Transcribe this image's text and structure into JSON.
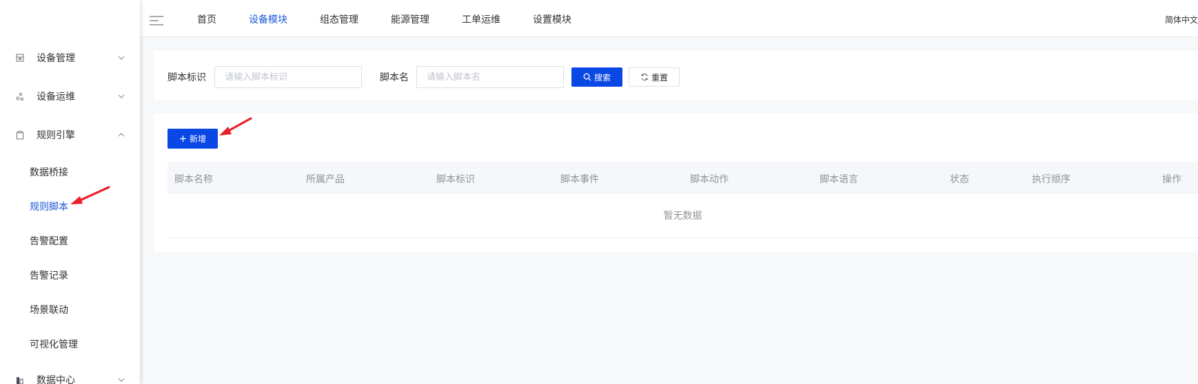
{
  "sidebar": {
    "groups": [
      {
        "label": "设备管理",
        "icon": "device-box-icon",
        "expanded": false
      },
      {
        "label": "设备运维",
        "icon": "nodes-icon",
        "expanded": false
      },
      {
        "label": "规则引擎",
        "icon": "clipboard-icon",
        "expanded": true
      },
      {
        "label": "数据中心",
        "icon": "database-icon",
        "expanded": false
      }
    ],
    "rule_engine_items": [
      {
        "label": "数据桥接",
        "active": false
      },
      {
        "label": "规则脚本",
        "active": true
      },
      {
        "label": "告警配置",
        "active": false
      },
      {
        "label": "告警记录",
        "active": false
      },
      {
        "label": "场景联动",
        "active": false
      },
      {
        "label": "可视化管理",
        "active": false
      }
    ]
  },
  "topnav": {
    "tabs": [
      {
        "label": "首页",
        "active": false
      },
      {
        "label": "设备模块",
        "active": true
      },
      {
        "label": "组态管理",
        "active": false
      },
      {
        "label": "能源管理",
        "active": false
      },
      {
        "label": "工单运维",
        "active": false
      },
      {
        "label": "设置模块",
        "active": false
      }
    ],
    "language": "简体中文"
  },
  "search": {
    "script_id_label": "脚本标识",
    "script_id_placeholder": "请输入脚本标识",
    "script_id_value": "",
    "script_name_label": "脚本名",
    "script_name_placeholder": "请输入脚本名",
    "script_name_value": "",
    "search_button": "搜索",
    "reset_button": "重置"
  },
  "table": {
    "add_button": "新增",
    "columns": [
      "脚本名称",
      "所属产品",
      "脚本标识",
      "脚本事件",
      "脚本动作",
      "脚本语言",
      "状态",
      "执行顺序",
      "操作"
    ],
    "rows": [],
    "empty_text": "暂无数据"
  },
  "colors": {
    "primary": "#0a48e6",
    "active_text": "#1a56db",
    "annotation_arrow": "#e8202a"
  }
}
